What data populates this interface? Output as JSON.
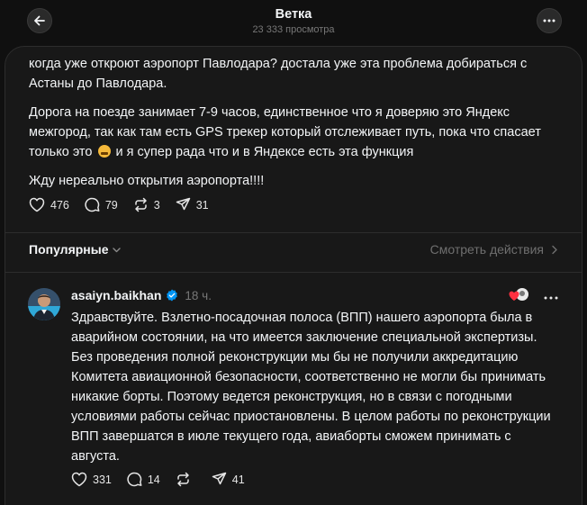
{
  "header": {
    "title": "Ветка",
    "views": "23 333 просмотра"
  },
  "post": {
    "paragraphs": [
      "когда уже откроют аэропорт Павлодара? достала уже эта проблема добираться с Астаны до Павлодара.",
      "Дорога на поезде занимает 7-9 часов, единственное что я доверяю это Яндекс межгород, так как там есть GPS трекер который отслеживает путь, пока что спасает только это",
      " и я супер рада что и в Яндексе есть эта функция",
      "Жду нереально открытия аэропорта!!!!"
    ],
    "stats": {
      "likes": "476",
      "replies": "79",
      "reposts": "3",
      "shares": "31"
    }
  },
  "section": {
    "popular_label": "Популярные",
    "see_activity_label": "Смотреть действия"
  },
  "reply": {
    "username": "asaiyn.baikhan",
    "time": "18 ч.",
    "text": "Здравствуйте. Взлетно-посадочная полоса (ВПП) нашего аэропорта была в аварийном состоянии, на что имеется заключение специальной экспертизы. Без проведения полной реконструкции мы бы не получили аккредитацию Комитета авиационной безопасности, соответственно не могли бы принимать никакие борты. Поэтому ведется реконструкция, но в связи с погодными условиями работы сейчас приостановлены. В целом работы по реконструкции ВПП завершатся в июле текущего года, авиаборты сможем принимать с августа.",
    "stats": {
      "likes": "331",
      "replies": "14",
      "shares": "41"
    }
  },
  "icons": {
    "back": "arrow-left-icon",
    "more": "more-horizontal-icon",
    "like": "heart-icon",
    "reply": "comment-icon",
    "repost": "repost-icon",
    "share": "send-icon",
    "verified": "verified-badge-icon",
    "chevron_down": "chevron-down-icon",
    "chevron_right": "chevron-right-icon"
  },
  "colors": {
    "background": "#101010",
    "card": "#181818",
    "border": "#2d2d2d",
    "text": "#f3f5f7",
    "muted": "#777777",
    "verified": "#0095f6",
    "liked_heart": "#ff3040"
  }
}
